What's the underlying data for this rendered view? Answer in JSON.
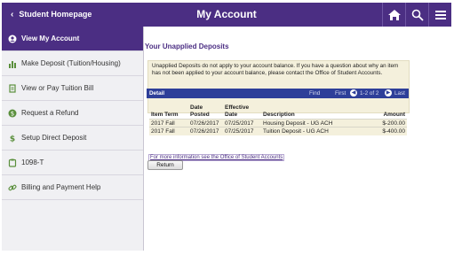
{
  "header": {
    "back_label": "Student Homepage",
    "title": "My Account",
    "icons": [
      "home-icon",
      "search-icon",
      "menu-icon"
    ]
  },
  "sidebar": {
    "items": [
      {
        "label": "View My Account",
        "icon": "user-circle-icon",
        "active": true
      },
      {
        "label": "Make Deposit (Tuition/Housing)",
        "icon": "bar-chart-icon"
      },
      {
        "label": "View or Pay Tuition Bill",
        "icon": "document-icon"
      },
      {
        "label": "Request a Refund",
        "icon": "dollar-circle-icon"
      },
      {
        "label": "Setup Direct Deposit",
        "icon": "dollar-icon"
      },
      {
        "label": "1098-T",
        "icon": "form-icon"
      },
      {
        "label": "Billing and Payment Help",
        "icon": "link-icon"
      }
    ]
  },
  "main": {
    "section_title": "Your Unapplied Deposits",
    "notice": "Unapplied Deposits do not apply to your account balance. If you have a question about why an item has not been applied to your account balance, please contact the Office of Student Accounts.",
    "grid": {
      "caption": "Detail",
      "find": "Find",
      "first": "First",
      "range": "1-2 of 2",
      "last": "Last",
      "columns": [
        "Item Term",
        "Date Posted",
        "Effective Date",
        "Description",
        "Amount"
      ],
      "rows": [
        [
          "2017 Fall",
          "07/26/2017",
          "07/25/2017",
          "Housing Deposit - UG ACH",
          "$-200.00"
        ],
        [
          "2017 Fall",
          "07/26/2017",
          "07/25/2017",
          "Tuition Deposit - UG ACH",
          "$-400.00"
        ]
      ]
    },
    "more_info_link": "For more information see the Office of Student Accounts",
    "return_label": "Return"
  },
  "colors": {
    "brand_purple": "#4b2e83",
    "grid_header_blue": "#2e3f99",
    "notice_bg": "#f4f0dc"
  }
}
